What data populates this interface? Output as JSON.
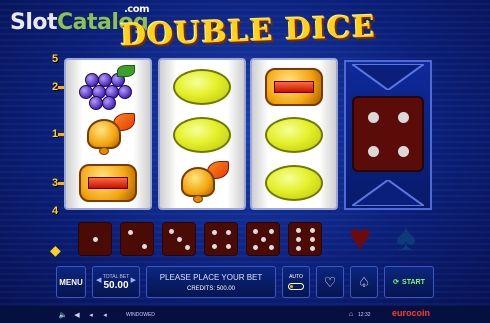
{
  "watermark": {
    "part_a": "Slot",
    "part_b": "Catalog",
    "suffix": ".com"
  },
  "game": {
    "title": "DOUBLE DICE"
  },
  "reels": [
    [
      "grapes",
      "bell",
      "bar"
    ],
    [
      "lemon",
      "lemon",
      "bell"
    ],
    [
      "bar",
      "lemon",
      "lemon"
    ]
  ],
  "line_numbers": {
    "left": [
      "5",
      "2",
      "1",
      "3",
      "4"
    ]
  },
  "big_die": {
    "value": 4
  },
  "dice_row": [
    1,
    2,
    3,
    4,
    5,
    6
  ],
  "suits": {
    "heart": "♥",
    "spade": "♠"
  },
  "controls": {
    "menu": "MENU",
    "total_bet_label": "TOTAL BET",
    "total_bet": "50.00",
    "message": "PLEASE PLACE YOUR BET",
    "credits": "CREDITS: 500.00",
    "auto": "AUTO",
    "heart": "♡",
    "spade": "♤",
    "start": "START"
  },
  "bottom_bar": {
    "mode": "WINDOWED",
    "time": "12:32",
    "brand": "eurocoin"
  },
  "icons": [
    "chip-icon",
    "sound-icon",
    "volume-icon",
    "info-icon",
    "fullscreen-icon",
    "home-icon",
    "settings-icon"
  ]
}
